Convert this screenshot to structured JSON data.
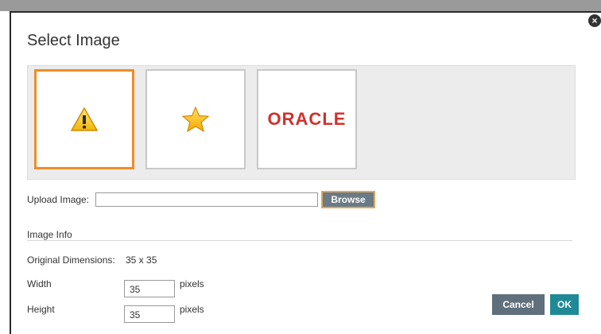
{
  "dialog": {
    "title": "Select Image",
    "close_icon": "close-circle-icon"
  },
  "gallery": {
    "images": [
      {
        "icon": "warning-icon",
        "selected": true
      },
      {
        "icon": "star-icon",
        "selected": false
      },
      {
        "text": "ORACLE",
        "selected": false
      }
    ]
  },
  "upload": {
    "label": "Upload Image:",
    "value": "",
    "browse_label": "Browse"
  },
  "image_info": {
    "section_label": "Image Info",
    "original_dimensions_label": "Original Dimensions:",
    "original_dimensions_value": "35 x 35",
    "width_label": "Width",
    "width_value": "35",
    "height_label": "Height",
    "height_value": "35",
    "units": "pixels"
  },
  "actions": {
    "cancel_label": "Cancel",
    "ok_label": "OK"
  },
  "colors": {
    "selected_border": "#f08c28",
    "ok_button": "#1f8a96",
    "cancel_button": "#5f6f7b",
    "oracle_red": "#d0312d"
  }
}
